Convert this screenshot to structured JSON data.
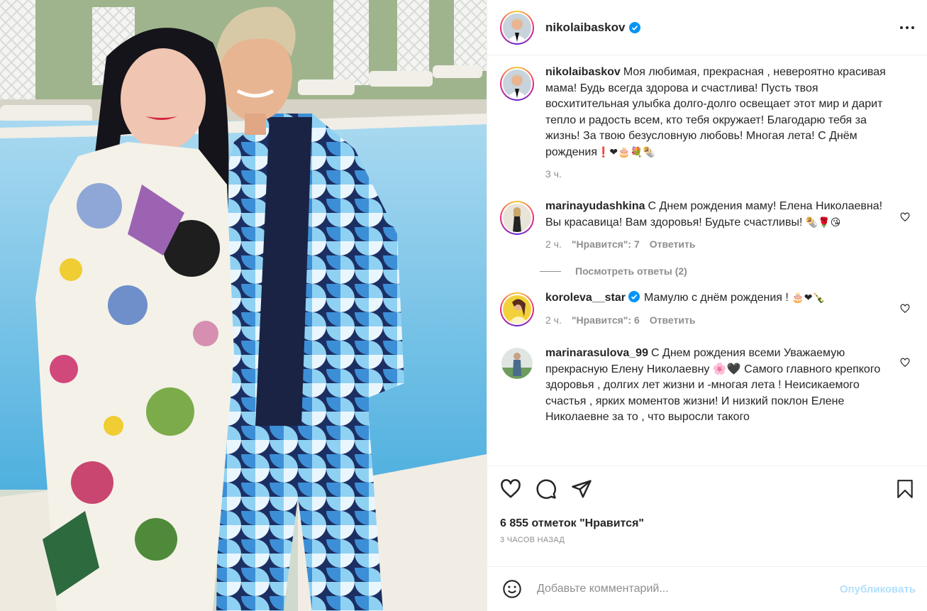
{
  "post": {
    "author": "nikolaibaskov",
    "caption": "Моя любимая, прекрасная , невероятно красивая мама! Будь всегда здорова и счастлива! Пусть твоя восхитительная улыбка долго-долго освещает этот мир и дарит тепло и радость всем, кто тебя окружает! Благодарю тебя за жизнь! За твою безусловную любовь! Многая лета! С Днём рождения",
    "caption_emoji": "❗❤🎂💐🌯",
    "caption_time": "3 ч."
  },
  "comments": [
    {
      "user": "marinayudashkina",
      "text": "С Днем рождения маму! Елена Николаевна! Вы красавица! Вам здоровья! Будьте счастливы!",
      "emoji": "🌯🌹😘",
      "time": "2 ч.",
      "likes": "\"Нравится\": 7",
      "reply": "Ответить",
      "view_replies": "Посмотреть ответы (2)"
    },
    {
      "user": "koroleva__star",
      "text": "Мамулю с днём рождения !",
      "emoji": "🎂❤🍾",
      "time": "2 ч.",
      "likes": "\"Нравится\": 6",
      "reply": "Ответить"
    },
    {
      "user": "marinarasulova_99",
      "text": "С Днем рождения всеми Уважаемую прекрасную Елену Николаевну 🌸🖤 Самого главного крепкого здоровья , долгих лет жизни и -многая лета ! Неисикаемого счастья , ярких моментов жизни! И низкий поклон Елене Николаевне за то , что выросли такого"
    }
  ],
  "actions": {
    "likes_text": "6 855 отметок \"Нравится\"",
    "time_ago": "3 ЧАСОВ НАЗАД"
  },
  "add_comment": {
    "placeholder": "Добавьте комментарий...",
    "publish": "Опубликовать"
  },
  "icons": [
    "more-icon",
    "verified-icon",
    "heart-icon",
    "comment-icon",
    "share-icon",
    "bookmark-icon",
    "emoji-icon"
  ],
  "colors": {
    "accent": "#0095f6",
    "publish_disabled": "#b2dffc",
    "muted": "#8e8e8e"
  }
}
